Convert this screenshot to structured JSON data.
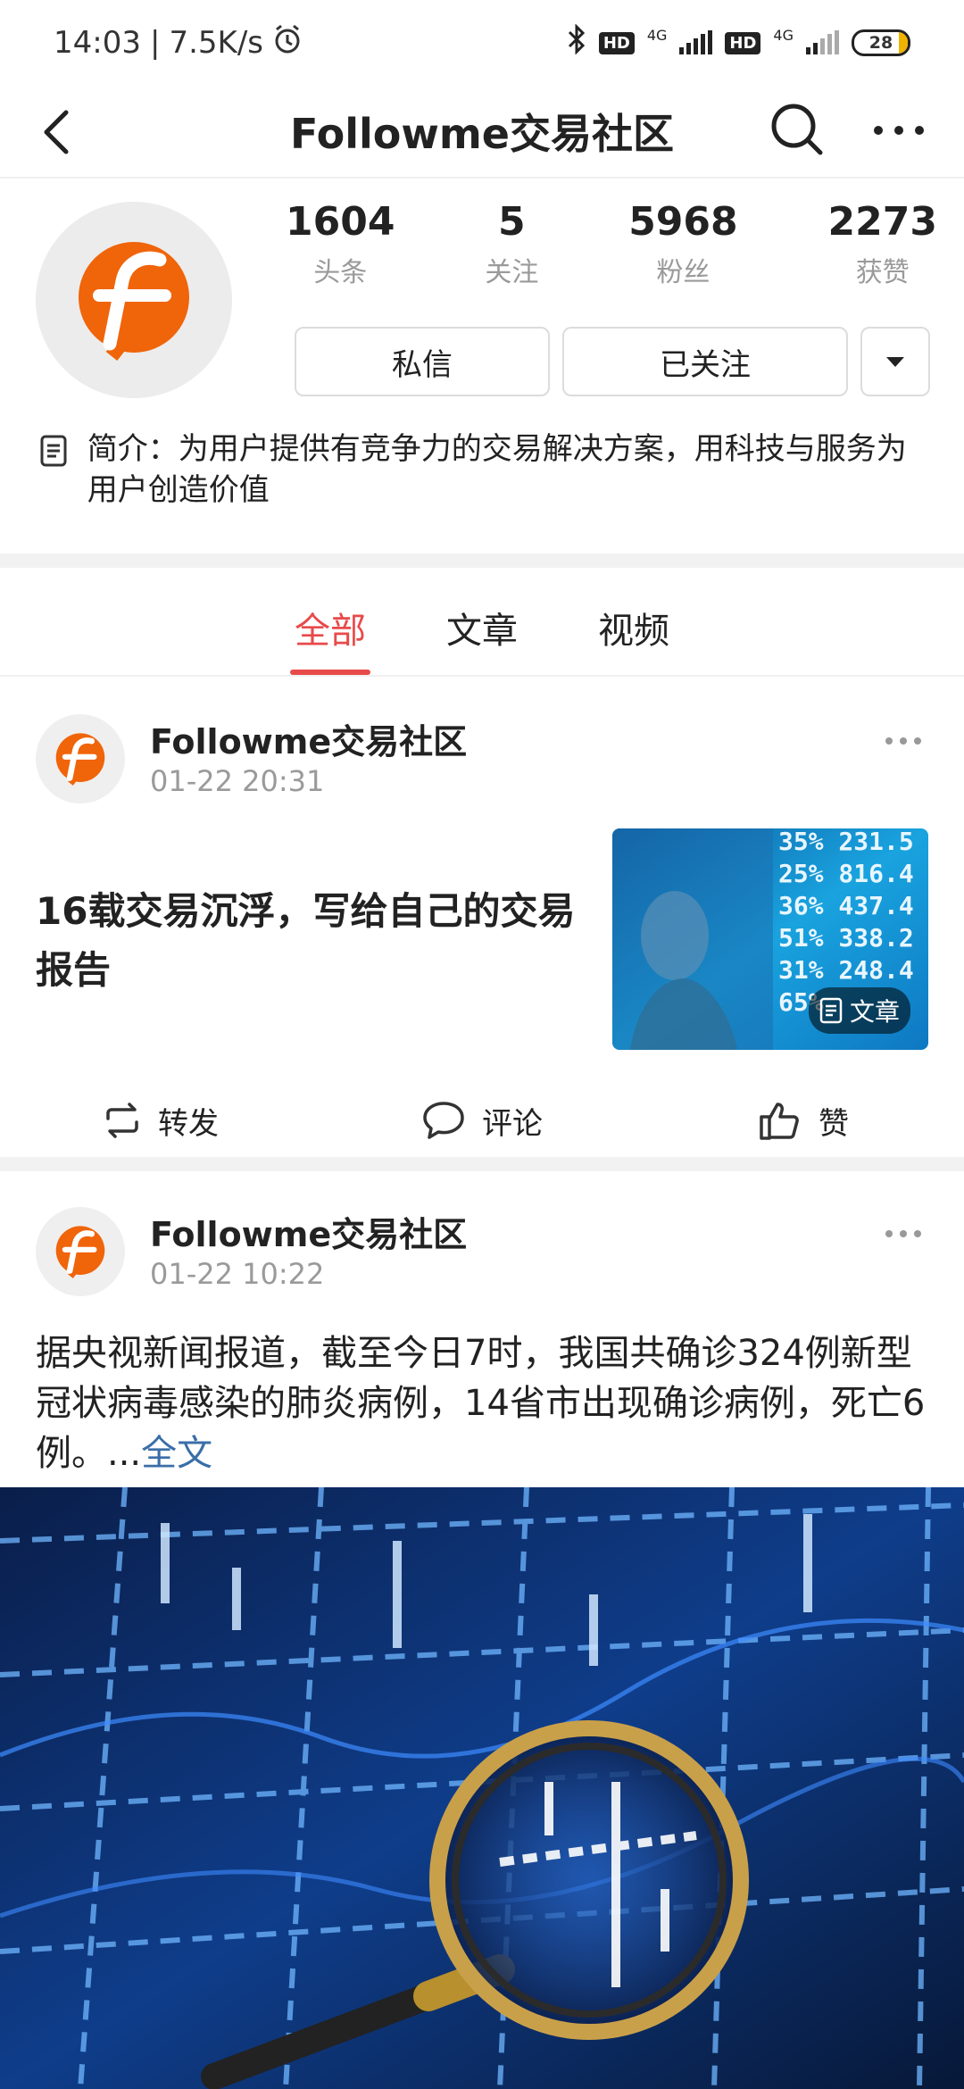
{
  "status_bar": {
    "time": "14:03",
    "speed": "7.5K/s",
    "network1": "4G",
    "network2": "4G",
    "hd": "HD",
    "battery": "28"
  },
  "nav": {
    "title": "Followme交易社区"
  },
  "profile": {
    "stats": [
      {
        "value": "1604",
        "label": "头条"
      },
      {
        "value": "5",
        "label": "关注"
      },
      {
        "value": "5968",
        "label": "粉丝"
      },
      {
        "value": "2273",
        "label": "获赞"
      }
    ],
    "message_button": "私信",
    "follow_button": "已关注",
    "intro": "简介：为用户提供有竞争力的交易解决方案，用科技与服务为用户创造价值"
  },
  "tabs": [
    {
      "label": "全部",
      "active": true
    },
    {
      "label": "文章",
      "active": false
    },
    {
      "label": "视频",
      "active": false
    }
  ],
  "posts": [
    {
      "author": "Followme交易社区",
      "time": "01-22 20:31",
      "title": "16载交易沉浮，写给自己的交易报告",
      "thumb_badge": "文章",
      "thumb_numbers": [
        "35% 231.5",
        "25% 816.4",
        "36% 437.4",
        "51% 338.2",
        "31% 248.4",
        "65%"
      ],
      "actions": {
        "repost": "转发",
        "comment": "评论",
        "like": "赞"
      }
    },
    {
      "author": "Followme交易社区",
      "time": "01-22 10:22",
      "text": "据央视新闻报道，截至今日7时，我国共确诊324例新型冠状病毒感染的肺炎病例，14省市出现确诊病例，死亡6例。...",
      "more_link": "全文"
    }
  ],
  "colors": {
    "accent": "#e84a4a",
    "brand_orange": "#f0640a",
    "link": "#3a6ea8"
  }
}
